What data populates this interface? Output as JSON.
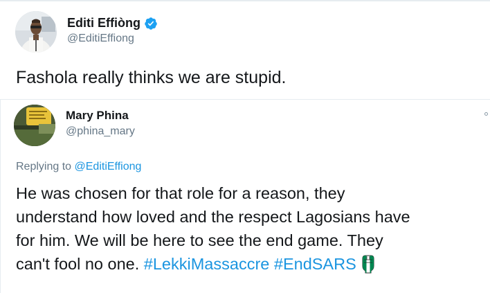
{
  "main_tweet": {
    "author_name": "Editi Effiòng",
    "author_handle": "@EditiEffiong",
    "verified_icon": "verified-badge-icon",
    "text": "Fashola really thinks we are stupid."
  },
  "reply": {
    "author_name": "Mary Phina",
    "author_handle": "@phina_mary",
    "replying_prefix": "Replying to ",
    "replying_mention": "@EditiEffiong",
    "lines": [
      "He was chosen for that role for a reason, they",
      "understand how loved and the respect Lagosians have",
      "for him. We will be here to see the end game. They",
      "can't fool no one. "
    ],
    "hashtags": [
      "#LekkiMassaccre",
      "#EndSARS"
    ],
    "emoji_icon": "raised-fist-nigeria-flag-icon"
  },
  "colors": {
    "text": "#14171a",
    "secondary": "#657786",
    "link": "#1b95e0",
    "verified": "#1da1f2",
    "nigeria_green": "#008751"
  }
}
